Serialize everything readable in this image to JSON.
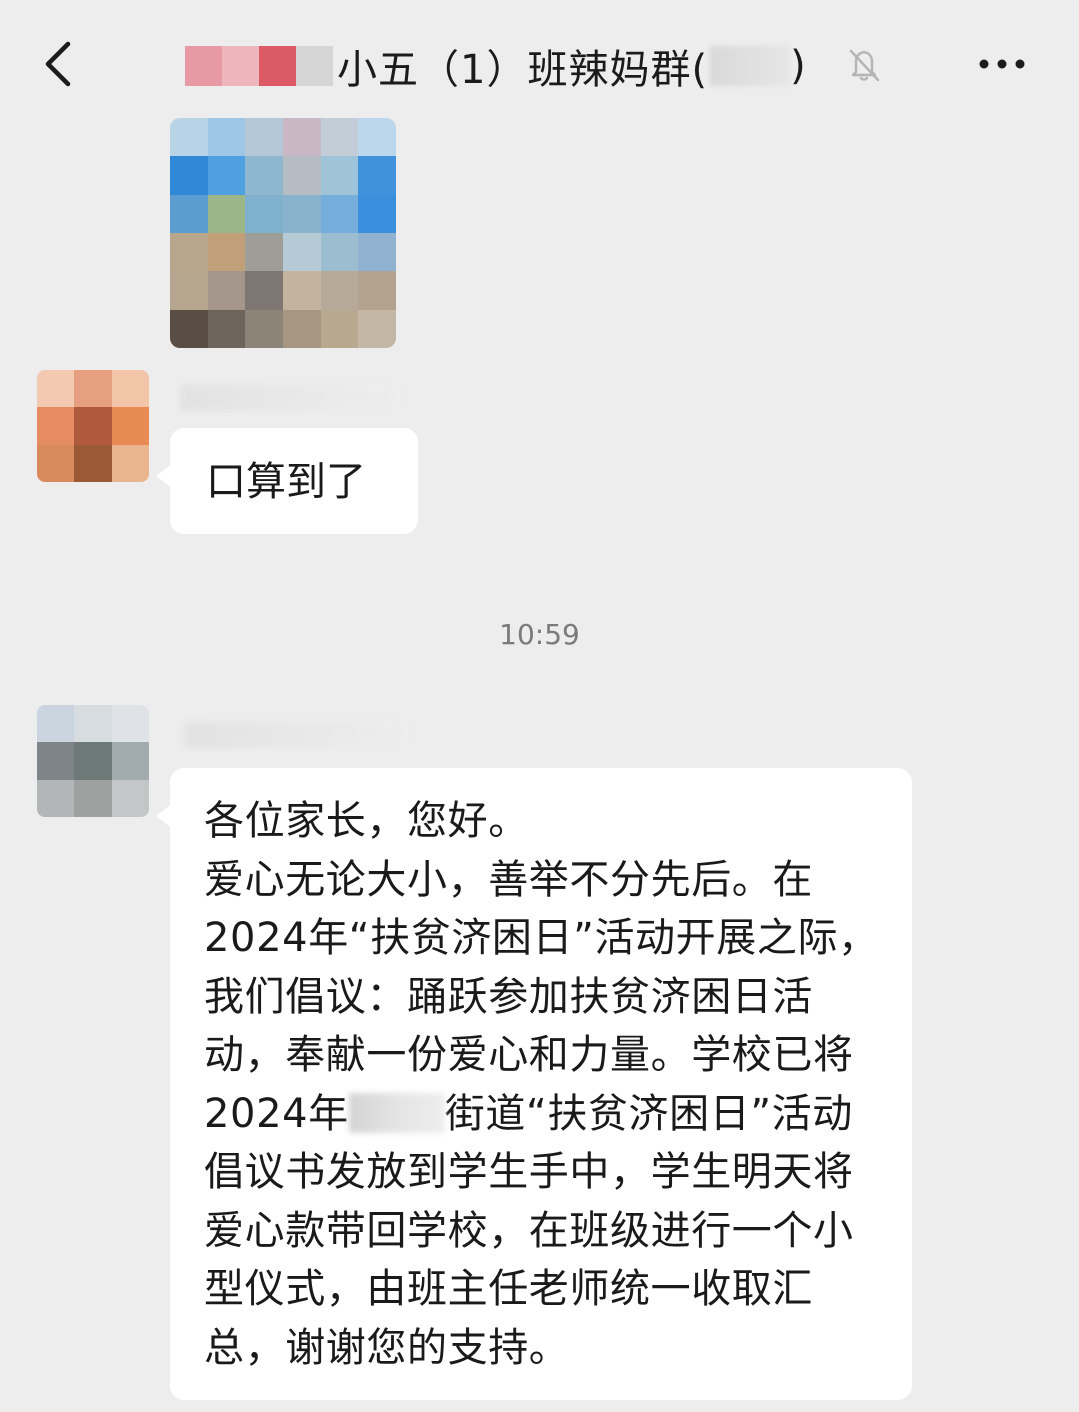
{
  "header": {
    "title": "小五（1）班辣妈群(",
    "title_suffix": ")",
    "back_icon": "chevron-left-icon",
    "mute_icon": "bell-muted-icon",
    "more_icon": "more-horizontal-icon"
  },
  "messages": [
    {
      "type": "image",
      "blurred": true
    },
    {
      "type": "text",
      "sender_blurred": true,
      "text": "口算到了"
    },
    {
      "type": "timestamp",
      "text": "10:59"
    },
    {
      "type": "text",
      "sender_blurred": true,
      "text_before": "各位家长，您好。\n爱心无论大小，善举不分先后。在2024年“扶贫济困日”活动开展之际，我们倡议：踊跃参加扶贫济困日活动，奉献一份爱心和力量。学校已将2024年",
      "text_after": "街道“扶贫济困日”活动倡议书发放到学生手中，学生明天将爱心款带回学校，在班级进行一个小型仪式，由班主任老师统一收取汇总，谢谢您的支持。"
    }
  ],
  "colors": {
    "background": "#ededed",
    "bubble": "#ffffff",
    "text": "#1a1a1a",
    "timestamp": "#7a7a7a"
  }
}
